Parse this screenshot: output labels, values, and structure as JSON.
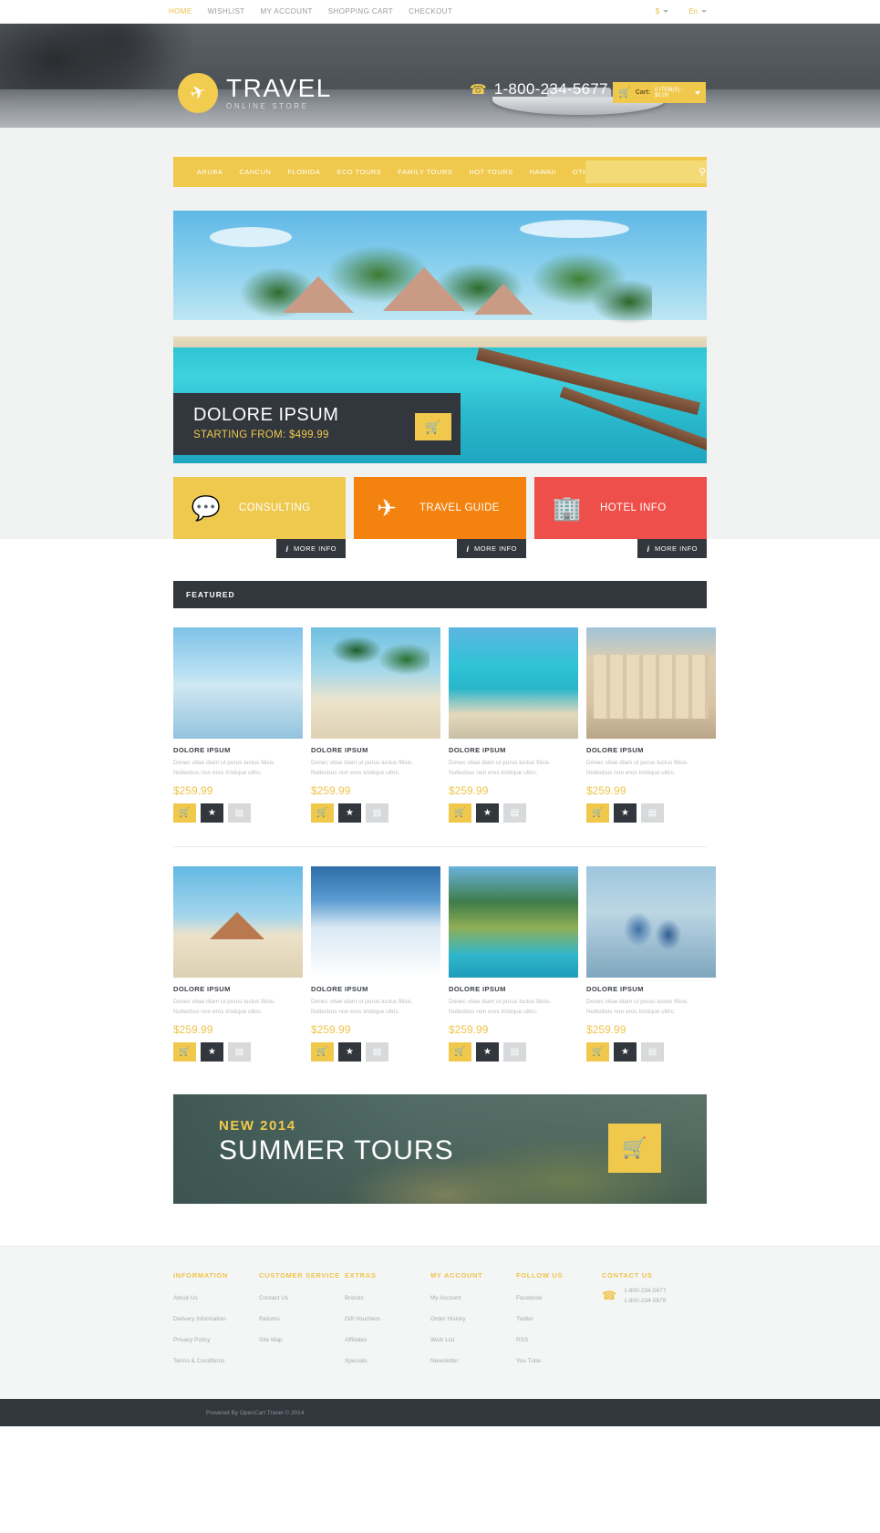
{
  "topbar": {
    "links": [
      {
        "label": "HOME",
        "active": true
      },
      {
        "label": "WISHLIST",
        "active": false
      },
      {
        "label": "MY ACCOUNT",
        "active": false
      },
      {
        "label": "SHOPPING CART",
        "active": false
      },
      {
        "label": "CHECKOUT",
        "active": false
      }
    ],
    "currency": "$",
    "language": "En"
  },
  "header": {
    "logo_icon": "airplane-icon",
    "logo_title": "TRAVEL",
    "logo_subtitle": "ONLINE STORE",
    "phone_icon": "phone-icon",
    "phone": "1-800-234-5677",
    "cart_icon": "shopping-cart-icon",
    "cart_label": "Cart:",
    "cart_value": "0 ITEM(S) - $0.00"
  },
  "menu": {
    "items": [
      "ARUBA",
      "CANCUN",
      "FLORIDA",
      "ECO TOURS",
      "FAMILY TOURS",
      "HOT TOURS",
      "HAWAII",
      "OTHER"
    ],
    "search_placeholder": "",
    "search_value": "",
    "search_icon": "search-icon"
  },
  "hero": {
    "title": "DOLORE IPSUM",
    "price_label": "STARTING FROM: $499.99",
    "cart_icon": "shopping-cart-icon"
  },
  "services": [
    {
      "label": "CONSULTING",
      "icon": "chat-bubbles-icon",
      "color": "#eec94e",
      "more_info": "MORE INFO",
      "info_icon": "info-icon"
    },
    {
      "label": "TRAVEL GUIDE",
      "icon": "airplane-icon",
      "color": "#f3820f",
      "more_info": "MORE INFO",
      "info_icon": "info-icon"
    },
    {
      "label": "HOTEL INFO",
      "icon": "building-icon",
      "color": "#ef4f4a",
      "more_info": "MORE INFO",
      "info_icon": "info-icon"
    }
  ],
  "featured": {
    "heading": "FEATURED",
    "row1": [
      {
        "name": "DOLORE IPSUM",
        "desc": "Donec vitae diam ut purus luctus filisis. Nullecbus non eros tristique ultric.",
        "price": "$259.99",
        "scene": "sc-salt"
      },
      {
        "name": "DOLORE IPSUM",
        "desc": "Donec vitae diam ut purus luctus filisis. Nullecbus non eros tristique ultric.",
        "price": "$259.99",
        "scene": "sc-palm"
      },
      {
        "name": "DOLORE IPSUM",
        "desc": "Donec vitae diam ut purus luctus filisis. Nullecbus non eros tristique ultric.",
        "price": "$259.99",
        "scene": "sc-bay"
      },
      {
        "name": "DOLORE IPSUM",
        "desc": "Donec vitae diam ut purus luctus filisis. Nullecbus non eros tristique ultric.",
        "price": "$259.99",
        "scene": "sc-resort"
      }
    ],
    "row2": [
      {
        "name": "DOLORE IPSUM",
        "desc": "Donec vitae diam ut purus luctus filisis. Nullecbus non eros tristique ultric.",
        "price": "$259.99",
        "scene": "sc-beachhut"
      },
      {
        "name": "DOLORE IPSUM",
        "desc": "Donec vitae diam ut purus luctus filisis. Nullecbus non eros tristique ultric.",
        "price": "$259.99",
        "scene": "sc-snow"
      },
      {
        "name": "DOLORE IPSUM",
        "desc": "Donec vitae diam ut purus luctus filisis. Nullecbus non eros tristique ultric.",
        "price": "$259.99",
        "scene": "sc-marina"
      },
      {
        "name": "DOLORE IPSUM",
        "desc": "Donec vitae diam ut purus luctus filisis. Nullecbus non eros tristique ultric.",
        "price": "$259.99",
        "scene": "sc-people"
      }
    ],
    "btn_cart_icon": "shopping-cart-icon",
    "btn_star_icon": "star-icon",
    "btn_compare_icon": "compare-icon"
  },
  "summer": {
    "eyebrow": "NEW 2014",
    "title": "SUMMER TOURS",
    "cart_icon": "shopping-cart-icon"
  },
  "footer": {
    "columns": [
      {
        "title": "INFORMATION",
        "links": [
          "About Us",
          "Delivery Information",
          "Privacy Policy",
          "Terms & Conditions"
        ]
      },
      {
        "title": "CUSTOMER SERVICE",
        "links": [
          "Contact Us",
          "Returns",
          "Site Map"
        ]
      },
      {
        "title": "EXTRAS",
        "links": [
          "Brands",
          "Gift Vouchers",
          "Affiliates",
          "Specials"
        ]
      },
      {
        "title": "MY ACCOUNT",
        "links": [
          "My Account",
          "Order History",
          "Wish List",
          "Newsletter"
        ]
      },
      {
        "title": "FOLLOW US",
        "links": [
          "Facebook",
          "Twitter",
          "RSS",
          "You Tube"
        ]
      }
    ],
    "contact": {
      "title": "CONTACT US",
      "icon": "phone-icon",
      "phones": [
        "1-800-234-5677",
        "1-800-234-5678"
      ]
    },
    "copyright": "Powered By OpenCart Travel © 2014"
  }
}
